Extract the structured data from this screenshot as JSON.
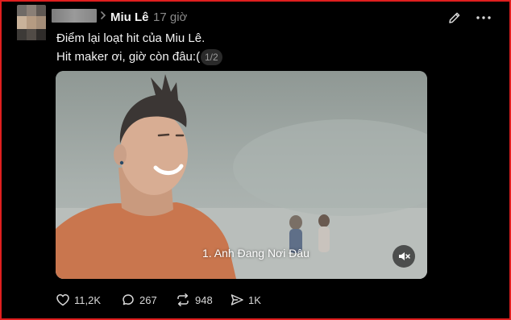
{
  "post": {
    "author": "Miu Lê",
    "time": "17 giờ",
    "text_line1": "Điểm lại loạt hit của Miu Lê.",
    "text_line2": "Hit maker ơi, giờ còn đâu:(",
    "page_indicator": "1/2"
  },
  "video": {
    "caption": "1. Anh Đang Nơi Đâu",
    "muted": true
  },
  "actions": {
    "likes": "11,2K",
    "comments": "267",
    "reposts": "948",
    "shares": "1K"
  },
  "icons": {
    "edit": "pencil-icon",
    "more": "more-horizontal-icon",
    "like": "heart-icon",
    "comment": "comment-bubble-icon",
    "repost": "repost-arrows-icon",
    "share": "send-icon",
    "mute": "speaker-muted-icon"
  },
  "colors": {
    "background": "#000000",
    "text": "#f3f3f3",
    "muted_text": "#8a8a8a",
    "frame_border": "#e01e1e"
  }
}
